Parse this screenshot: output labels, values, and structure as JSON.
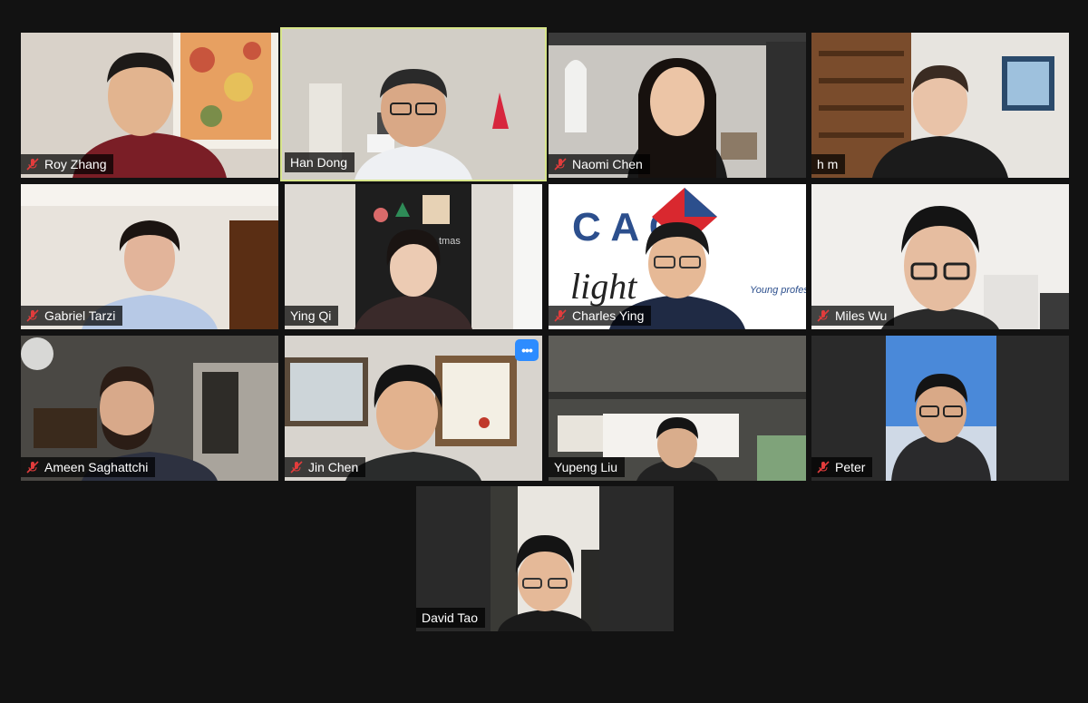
{
  "meeting": {
    "participants": [
      {
        "name": "Roy Zhang",
        "muted": true
      },
      {
        "name": "Han Dong",
        "muted": false,
        "active_speaker": true
      },
      {
        "name": "Naomi Chen",
        "muted": true
      },
      {
        "name": "h m",
        "muted": false
      },
      {
        "name": "Gabriel Tarzi",
        "muted": true
      },
      {
        "name": "Ying Qi",
        "muted": false
      },
      {
        "name": "Charles Ying",
        "muted": true
      },
      {
        "name": "Miles Wu",
        "muted": true
      },
      {
        "name": "Ameen Saghattchi",
        "muted": true
      },
      {
        "name": "Jin Chen",
        "muted": true
      },
      {
        "name": "Yupeng Liu",
        "muted": false
      },
      {
        "name": "Peter",
        "muted": true
      },
      {
        "name": "David Tao",
        "muted": false
      }
    ],
    "more_button_label": "•••",
    "sign_text": {
      "logo_letters": "C  A  C",
      "script": "light",
      "tagline": "Young profess"
    },
    "board_text": "tmas"
  },
  "colors": {
    "active_border": "#d7e58a",
    "mute_icon": "#e23c3c",
    "more_button": "#2d8cff"
  }
}
